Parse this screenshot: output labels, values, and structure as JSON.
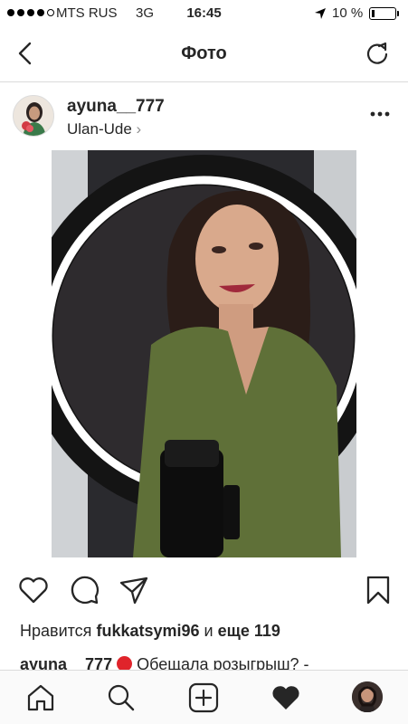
{
  "status_bar": {
    "carrier": "MTS RUS",
    "network": "3G",
    "time": "16:45",
    "battery_percent": "10 %"
  },
  "header": {
    "title": "Фото",
    "back_icon": "chevron-left-icon",
    "refresh_icon": "refresh-icon"
  },
  "post": {
    "username": "ayuna__777",
    "location": "Ulan-Ude",
    "location_chevron": "›",
    "more_icon": "more-dots-icon"
  },
  "actions": {
    "like_icon": "heart-outline-icon",
    "comment_icon": "comment-icon",
    "share_icon": "send-icon",
    "save_icon": "bookmark-icon"
  },
  "likes": {
    "prefix": "Нравится",
    "user": "fukkatsymi96",
    "middle": "и",
    "rest": "еще 119"
  },
  "caption": {
    "username": "ayuna__777",
    "text": "Обещала розыгрыш? -"
  },
  "tab_bar": {
    "home_icon": "home-icon",
    "search_icon": "search-icon",
    "add_icon": "plus-square-icon",
    "activity_icon": "heart-filled-icon",
    "profile_icon": "profile-avatar"
  },
  "colors": {
    "text": "#262626",
    "divider": "#dbdbdb",
    "caption_emoji": "#e0242b"
  }
}
